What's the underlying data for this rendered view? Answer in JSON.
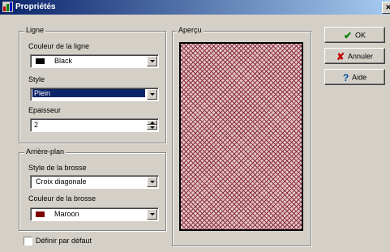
{
  "window": {
    "title": "Propriétés",
    "close_symbol": "✕"
  },
  "line_group": {
    "legend": "Ligne",
    "color_label": "Couleur de la ligne",
    "color_value": "Black",
    "color_swatch": "#000000",
    "style_label": "Style",
    "style_value": "Plein",
    "thickness_label": "Epaisseur",
    "thickness_value": "2"
  },
  "background_group": {
    "legend": "Arrière-plan",
    "brush_style_label": "Style de la brosse",
    "brush_style_value": "Croix diagonale",
    "brush_color_label": "Couleur de la brosse",
    "brush_color_value": "Maroon",
    "brush_swatch": "#800000"
  },
  "preview": {
    "legend": "Aperçu"
  },
  "default_checkbox": {
    "label": "Définir par défaut",
    "checked": false
  },
  "buttons": {
    "ok": {
      "label": "OK",
      "icon": "check-icon"
    },
    "cancel": {
      "label": "Annuler",
      "icon": "x-icon"
    },
    "help": {
      "label": "Aide",
      "icon": "question-icon"
    }
  }
}
